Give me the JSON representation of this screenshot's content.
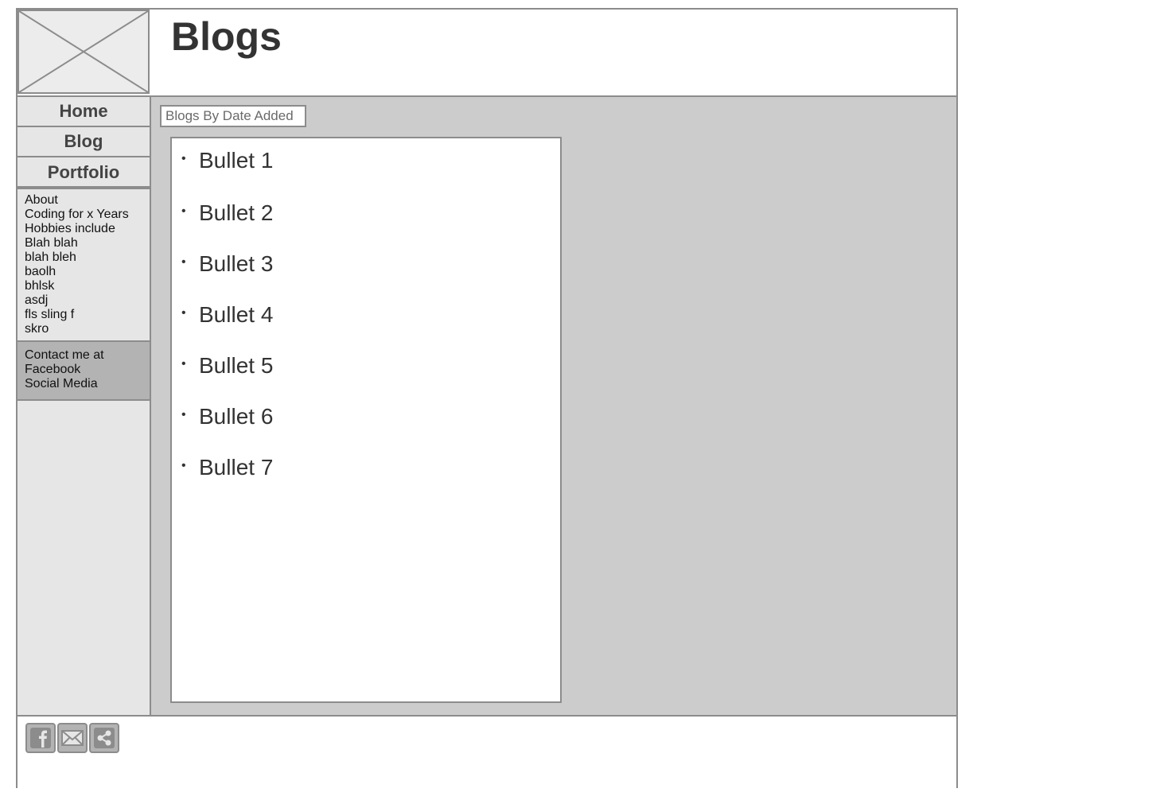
{
  "header": {
    "title": "Blogs",
    "logo_icon": "image-placeholder-icon"
  },
  "nav": {
    "items": [
      {
        "label": "Home"
      },
      {
        "label": "Blog"
      },
      {
        "label": "Portfolio"
      }
    ]
  },
  "about": {
    "lines": [
      "About",
      "Coding for x Years",
      "Hobbies include",
      "Blah blah",
      "blah bleh",
      "baolh",
      "bhlsk",
      "asdj",
      "fls sling f",
      "skro"
    ]
  },
  "contact": {
    "lines": [
      "Contact me at",
      "Facebook",
      "Social Media"
    ]
  },
  "main": {
    "filter_placeholder": "Blogs By Date Added",
    "bullets": [
      "Bullet 1",
      "Bullet 2",
      "Bullet 3",
      "Bullet 4",
      "Bullet 5",
      "Bullet 6",
      "Bullet 7"
    ]
  },
  "footer": {
    "social_icons": [
      "facebook-icon",
      "email-icon",
      "share-icon"
    ]
  },
  "colors": {
    "border": "#8c8c8c",
    "sidebar_bg": "#e6e6e6",
    "main_bg": "#cccccc",
    "contact_bg": "#b3b3b3",
    "text": "#333333"
  }
}
